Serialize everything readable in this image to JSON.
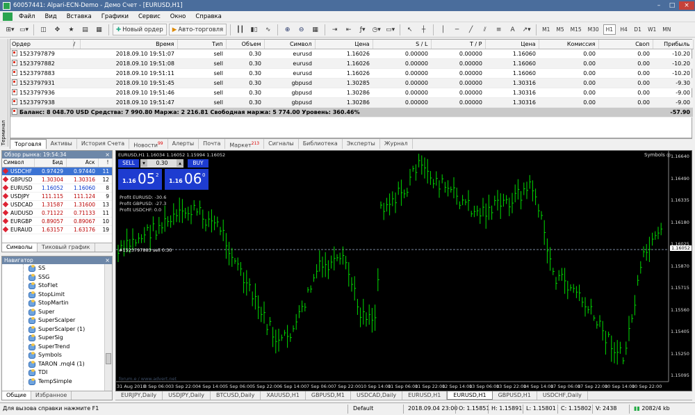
{
  "window": {
    "title": "60057441: Alpari-ECN-Demo - Демо Счет - [EURUSD,H1]",
    "controls": [
      "–",
      "□",
      "×"
    ]
  },
  "menu": [
    "Файл",
    "Вид",
    "Вставка",
    "Графики",
    "Сервис",
    "Окно",
    "Справка"
  ],
  "toolbar": {
    "new_order": "Новый ордер",
    "auto_trading": "Авто-торговля",
    "timeframes": [
      "M1",
      "M5",
      "M15",
      "M30",
      "H1",
      "H4",
      "D1",
      "W1",
      "MN"
    ],
    "active_timeframe": "H1"
  },
  "terminal": {
    "side_label": "Терминал",
    "columns": [
      "Ордер",
      "/",
      "Время",
      "Тип",
      "Объем",
      "Символ",
      "Цена",
      "S / L",
      "T / P",
      "Цена",
      "Комиссия",
      "Своп",
      "Прибыль"
    ],
    "orders": [
      {
        "id": "1523797879",
        "time": "2018.09.10 19:51:07",
        "type": "sell",
        "volume": "0.30",
        "symbol": "eurusd",
        "price": "1.16026",
        "sl": "0.00000",
        "tp": "0.00000",
        "cur": "1.16060",
        "commission": "0.00",
        "swap": "0.00",
        "profit": "-10.20"
      },
      {
        "id": "1523797882",
        "time": "2018.09.10 19:51:08",
        "type": "sell",
        "volume": "0.30",
        "symbol": "eurusd",
        "price": "1.16026",
        "sl": "0.00000",
        "tp": "0.00000",
        "cur": "1.16060",
        "commission": "0.00",
        "swap": "0.00",
        "profit": "-10.20"
      },
      {
        "id": "1523797883",
        "time": "2018.09.10 19:51:11",
        "type": "sell",
        "volume": "0.30",
        "symbol": "eurusd",
        "price": "1.16026",
        "sl": "0.00000",
        "tp": "0.00000",
        "cur": "1.16060",
        "commission": "0.00",
        "swap": "0.00",
        "profit": "-10.20"
      },
      {
        "id": "1523797931",
        "time": "2018.09.10 19:51:45",
        "type": "sell",
        "volume": "0.30",
        "symbol": "gbpusd",
        "price": "1.30285",
        "sl": "0.00000",
        "tp": "0.00000",
        "cur": "1.30316",
        "commission": "0.00",
        "swap": "0.00",
        "profit": "-9.30"
      },
      {
        "id": "1523797936",
        "time": "2018.09.10 19:51:46",
        "type": "sell",
        "volume": "0.30",
        "symbol": "gbpusd",
        "price": "1.30286",
        "sl": "0.00000",
        "tp": "0.00000",
        "cur": "1.30316",
        "commission": "0.00",
        "swap": "0.00",
        "profit": "-9.00"
      },
      {
        "id": "1523797938",
        "time": "2018.09.10 19:51:47",
        "type": "sell",
        "volume": "0.30",
        "symbol": "gbpusd",
        "price": "1.30286",
        "sl": "0.00000",
        "tp": "0.00000",
        "cur": "1.30316",
        "commission": "0.00",
        "swap": "0.00",
        "profit": "-9.00"
      }
    ],
    "balance_line": "Баланс: 8 048.70 USD  Средства: 7 990.80  Маржа: 2 216.81  Свободная маржа: 5 774.00  Уровень: 360.46%",
    "total_profit": "-57.90",
    "tabs": [
      {
        "label": "Торговля",
        "badge": ""
      },
      {
        "label": "Активы",
        "badge": ""
      },
      {
        "label": "История Счета",
        "badge": ""
      },
      {
        "label": "Новости",
        "badge": "99"
      },
      {
        "label": "Алерты",
        "badge": ""
      },
      {
        "label": "Почта",
        "badge": ""
      },
      {
        "label": "Маркет",
        "badge": "213"
      },
      {
        "label": "Сигналы",
        "badge": ""
      },
      {
        "label": "Библиотека",
        "badge": ""
      },
      {
        "label": "Эксперты",
        "badge": ""
      },
      {
        "label": "Журнал",
        "badge": ""
      }
    ]
  },
  "market_watch": {
    "title": "Обзор рынка: 19:54:34",
    "columns": [
      "Символ",
      "Бид",
      "Аск",
      "!"
    ],
    "rows": [
      {
        "symbol": "USDCHF",
        "bid": "0.97429",
        "ask": "0.97440",
        "spread": "11",
        "color": "#d23"
      },
      {
        "symbol": "GBPUSD",
        "bid": "1.30304",
        "ask": "1.30316",
        "spread": "12",
        "color": "#d23"
      },
      {
        "symbol": "EURUSD",
        "bid": "1.16052",
        "ask": "1.16060",
        "spread": "8",
        "color": "#d23"
      },
      {
        "symbol": "USDJPY",
        "bid": "111.115",
        "ask": "111.124",
        "spread": "9",
        "color": "#d23"
      },
      {
        "symbol": "USDCAD",
        "bid": "1.31587",
        "ask": "1.31600",
        "spread": "13",
        "color": "#d23"
      },
      {
        "symbol": "AUDUSD",
        "bid": "0.71122",
        "ask": "0.71133",
        "spread": "11",
        "color": "#d23"
      },
      {
        "symbol": "EURGBP",
        "bid": "0.89057",
        "ask": "0.89067",
        "spread": "10",
        "color": "#d23"
      },
      {
        "symbol": "EURAUD",
        "bid": "1.63157",
        "ask": "1.63176",
        "spread": "19",
        "color": "#d23"
      }
    ],
    "tabs": [
      "Символы",
      "Тиковый график"
    ]
  },
  "navigator": {
    "title": "Навигатор",
    "items": [
      "SS",
      "SSG",
      "StoFlet",
      "StopLimit",
      "StopMartin",
      "Super",
      "SuperScalper",
      "SuperScalper (1)",
      "SuperSig",
      "SuperTrend",
      "Symbols",
      "TARON .mql4 (1)",
      "TDI",
      "TempSimple"
    ],
    "tabs": [
      "Общие",
      "Избранное"
    ]
  },
  "chart": {
    "header": "EURUSD,H1  1.16034 1.16052 1.15994 1.16052",
    "symbols_label": "Symbols",
    "one_click": {
      "sell_label": "SELL",
      "buy_label": "BUY",
      "lot": "0.30",
      "sell_big": "1.16",
      "sell_pips": "05",
      "sell_sup": "2",
      "buy_big": "1.16",
      "buy_pips": "06",
      "buy_sup": "0"
    },
    "profits": [
      "Profit EURUSD: -30.6",
      "Profit GBPUSD: -27.3",
      "Profit USDCHF: 0.0"
    ],
    "order_line_label": "#1523797883 sell 0.30",
    "watermark": "forum.e / www.advert.net",
    "current_price": "1.16052",
    "price_axis": [
      "1.16640",
      "1.16490",
      "1.16335",
      "1.16180",
      "1.16025",
      "1.15870",
      "1.15715",
      "1.15560",
      "1.15405",
      "1.15250",
      "1.15095"
    ],
    "time_axis": [
      "31 Aug 2018",
      "3 Sep 06:00",
      "3 Sep 22:00",
      "4 Sep 14:00",
      "5 Sep 06:00",
      "5 Sep 22:00",
      "6 Sep 14:00",
      "7 Sep 06:00",
      "7 Sep 22:00",
      "10 Sep 14:00",
      "11 Sep 06:00",
      "11 Sep 22:00",
      "12 Sep 14:00",
      "13 Sep 06:00",
      "13 Sep 22:00",
      "14 Sep 14:00",
      "17 Sep 06:00",
      "17 Sep 22:00",
      "10 Sep 14:00",
      "10 Sep 22:00"
    ],
    "up_color": "#00dd00",
    "down_color": "#00dd00"
  },
  "chart_tabs": [
    "EURJPY,Daily",
    "USDJPY,Daily",
    "BTCUSD,Daily",
    "XAUUSD,H1",
    "GBPUSD,M1",
    "USDCAD,Daily",
    "EURUSD,H1",
    "EURUSD,H1",
    "GBPUSD,H1",
    "USDCHF,Daily"
  ],
  "active_chart_tab": "EURUSD,H1",
  "status": {
    "help": "Для вызова справки нажмите F1",
    "profile": "Default",
    "time": "2018.09.04 23:00",
    "open": "O: 1.15851",
    "high": "H: 1.15891",
    "low": "L: 1.15801",
    "close": "C: 1.15802",
    "volume": "V: 2438",
    "traffic": "2082/4 kb"
  }
}
